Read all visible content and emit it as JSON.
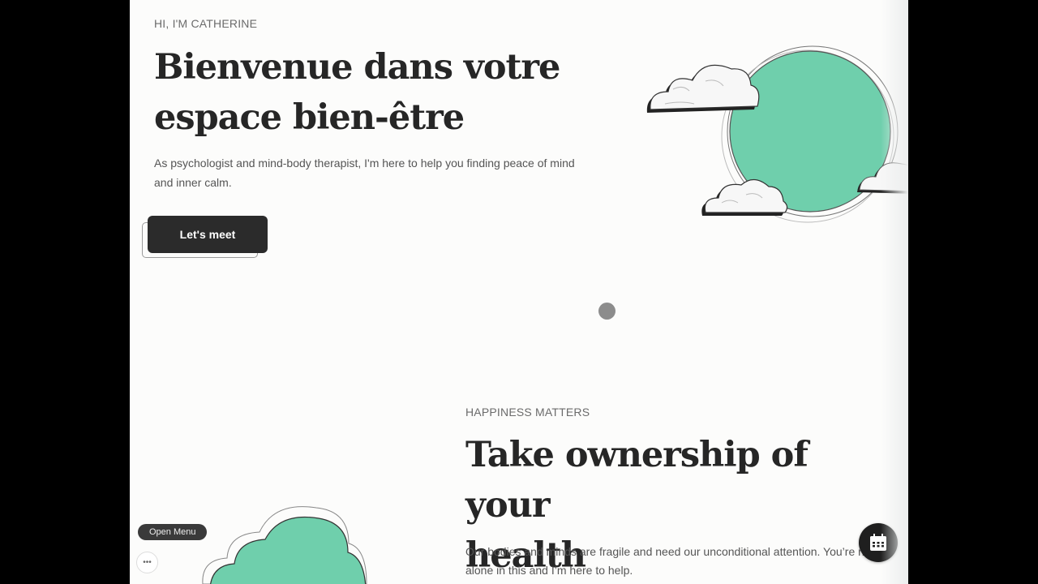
{
  "hero": {
    "eyebrow": "HI, I'M CATHERINE",
    "title_line1": "Bienvenue dans votre",
    "title_line2": "espace bien-être",
    "description": "As psychologist and mind-body therapist, I'm here to help you finding peace of mind and inner calm.",
    "cta_label": "Let's meet"
  },
  "section2": {
    "eyebrow": "HAPPINESS MATTERS",
    "title_line1": "Take ownership of your",
    "title_line2": "health",
    "description": "Our bodies and minds are fragile and need our unconditional attention. You’re not alone in this and I’m here to help."
  },
  "widgets": {
    "open_menu_label": "Open Menu",
    "more_icon": "more-dots-icon",
    "calendar_icon": "calendar-icon"
  },
  "colors": {
    "accent": "#6fcfac",
    "button_bg": "#2b2b2b",
    "text_dark": "#262626"
  }
}
